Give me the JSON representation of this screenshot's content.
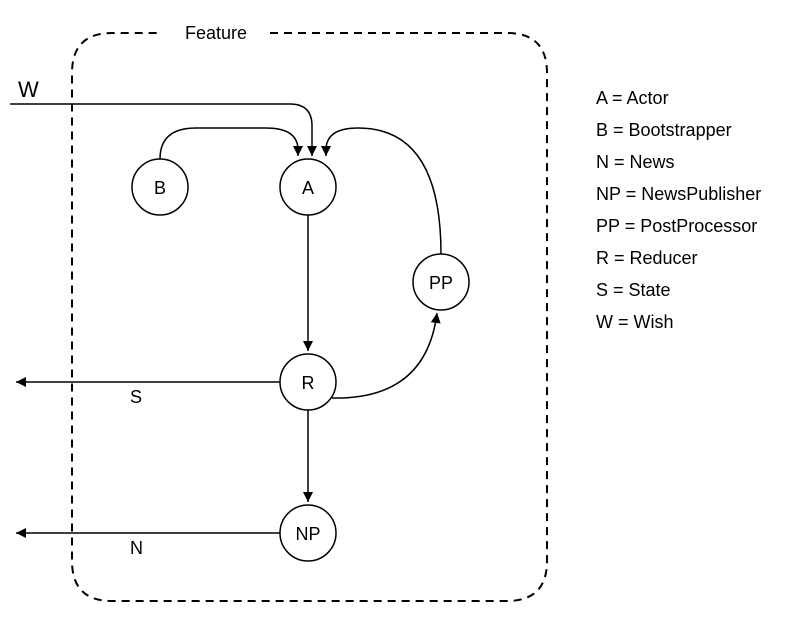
{
  "title": "Feature",
  "nodes": {
    "B": {
      "label": "B"
    },
    "A": {
      "label": "A"
    },
    "PP": {
      "label": "PP"
    },
    "R": {
      "label": "R"
    },
    "NP": {
      "label": "NP"
    }
  },
  "external": {
    "W_in": {
      "label": "W"
    },
    "S_out": {
      "label": "S"
    },
    "N_out": {
      "label": "N"
    }
  },
  "legend": [
    {
      "abbr": "A",
      "desc": "Actor"
    },
    {
      "abbr": "B",
      "desc": "Bootstrapper"
    },
    {
      "abbr": "N",
      "desc": "News"
    },
    {
      "abbr": "NP",
      "desc": "NewsPublisher"
    },
    {
      "abbr": "PP",
      "desc": "PostProcessor"
    },
    {
      "abbr": "R",
      "desc": "Reducer"
    },
    {
      "abbr": "S",
      "desc": "State"
    },
    {
      "abbr": "W",
      "desc": "Wish"
    }
  ],
  "colors": {
    "stroke": "#000000"
  }
}
